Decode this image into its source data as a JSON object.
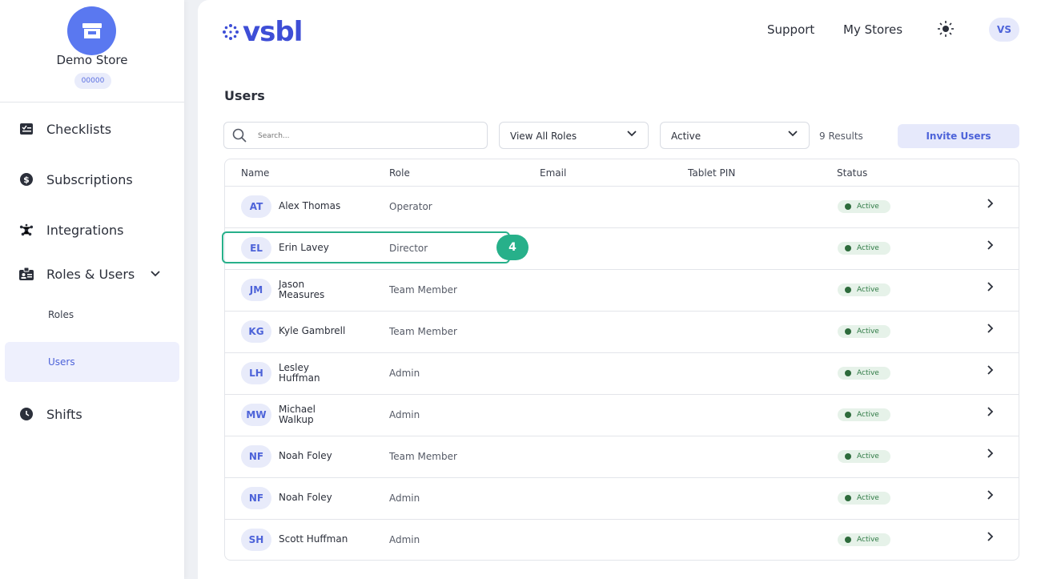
{
  "store": {
    "name": "Demo Store",
    "code": "00000"
  },
  "nav": {
    "items": [
      {
        "label": "Checklists",
        "icon": "checklist-icon"
      },
      {
        "label": "Subscriptions",
        "icon": "dollar-circle-icon"
      },
      {
        "label": "Integrations",
        "icon": "network-icon"
      },
      {
        "label": "Roles & Users",
        "icon": "id-badge-icon"
      },
      {
        "label": "Shifts",
        "icon": "clock-icon"
      }
    ],
    "sub": {
      "roles": "Roles",
      "users": "Users"
    }
  },
  "header": {
    "logo": "vsbl",
    "support": "Support",
    "my_stores": "My Stores",
    "user_initials": "VS"
  },
  "page": {
    "title": "Users"
  },
  "filters": {
    "search_placeholder": "Search...",
    "roles_value": "View All Roles",
    "status_value": "Active",
    "results": "9 Results",
    "invite": "Invite Users"
  },
  "table": {
    "headers": {
      "name": "Name",
      "role": "Role",
      "email": "Email",
      "pin": "Tablet PIN",
      "status": "Status"
    },
    "rows": [
      {
        "initials": "AT",
        "name": "Alex Thomas",
        "role": "Operator",
        "status": "Active"
      },
      {
        "initials": "EL",
        "name": "Erin Lavey",
        "role": "Director",
        "status": "Active"
      },
      {
        "initials": "JM",
        "name": "Jason Measures",
        "role": "Team Member",
        "status": "Active"
      },
      {
        "initials": "KG",
        "name": "Kyle Gambrell",
        "role": "Team Member",
        "status": "Active"
      },
      {
        "initials": "LH",
        "name": "Lesley Huffman",
        "role": "Admin",
        "status": "Active"
      },
      {
        "initials": "MW",
        "name": "Michael Walkup",
        "role": "Admin",
        "status": "Active"
      },
      {
        "initials": "NF",
        "name": "Noah Foley",
        "role": "Team Member",
        "status": "Active"
      },
      {
        "initials": "NF",
        "name": "Noah Foley",
        "role": "Admin",
        "status": "Active"
      },
      {
        "initials": "SH",
        "name": "Scott Huffman",
        "role": "Admin",
        "status": "Active"
      }
    ]
  },
  "step_badge": "4",
  "colors": {
    "accent": "#4d63d9",
    "highlight": "#27b08a",
    "status_bg": "#e6f2e9"
  }
}
